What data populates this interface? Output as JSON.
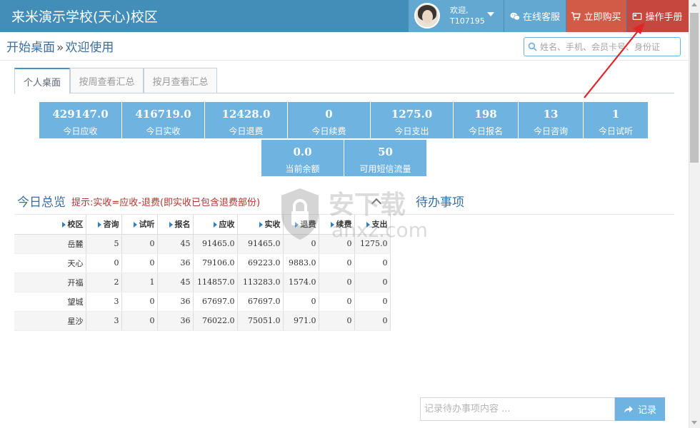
{
  "header": {
    "title": "来米演示学校(天心)校区",
    "welcome": "欢迎,",
    "username": "T107195",
    "service_label": "在线客服",
    "buy_label": "立即购买",
    "manual_label": "操作手册"
  },
  "breadcrumb": {
    "home": "开始桌面",
    "separator": "»",
    "current": "欢迎使用"
  },
  "search": {
    "placeholder": "姓名、手机、会员卡号、身份证"
  },
  "tabs": [
    "个人桌面",
    "按周查看汇总",
    "按月查看汇总"
  ],
  "stats_row1": [
    {
      "value": "429147.0",
      "label": "今日应收"
    },
    {
      "value": "416719.0",
      "label": "今日实收"
    },
    {
      "value": "12428.0",
      "label": "今日退费"
    },
    {
      "value": "0",
      "label": "今日续费"
    },
    {
      "value": "1275.0",
      "label": "今日支出"
    },
    {
      "value": "198",
      "label": "今日报名"
    },
    {
      "value": "13",
      "label": "今日咨询"
    },
    {
      "value": "1",
      "label": "今日试听"
    }
  ],
  "stats_row2": [
    {
      "value": "0.0",
      "label": "当前余额"
    },
    {
      "value": "50",
      "label": "可用短信流量"
    }
  ],
  "summary": {
    "title": "今日总览",
    "hint": "提示:实收=应收-退费(即实收已包含退费部份)",
    "columns": [
      "校区",
      "咨询",
      "试听",
      "报名",
      "应收",
      "实收",
      "退费",
      "续费",
      "支出"
    ],
    "rows": [
      [
        "岳麓",
        "5",
        "0",
        "45",
        "91465.0",
        "91465.0",
        "0",
        "0",
        "1275.0"
      ],
      [
        "天心",
        "0",
        "0",
        "36",
        "79106.0",
        "69223.0",
        "9883.0",
        "0",
        "0"
      ],
      [
        "开福",
        "2",
        "1",
        "45",
        "114857.0",
        "113283.0",
        "1574.0",
        "0",
        "0"
      ],
      [
        "望城",
        "3",
        "0",
        "36",
        "67697.0",
        "67697.0",
        "0",
        "0",
        "0"
      ],
      [
        "星沙",
        "3",
        "0",
        "36",
        "76022.0",
        "75051.0",
        "971.0",
        "0",
        "0"
      ]
    ]
  },
  "todo": {
    "title": "待办事项",
    "input_placeholder": "记录待办事项内容 ...",
    "record_label": "记录"
  },
  "watermark": {
    "brand": "安下载",
    "domain": "anxz.com"
  },
  "colors": {
    "topbar": "#438eb9",
    "stat_box": "#6fb3e0",
    "buy_button": "#d15b47",
    "manual_button": "#c6473d",
    "annotation_arrow": "#e0262b",
    "hint_text": "#b1352d"
  }
}
